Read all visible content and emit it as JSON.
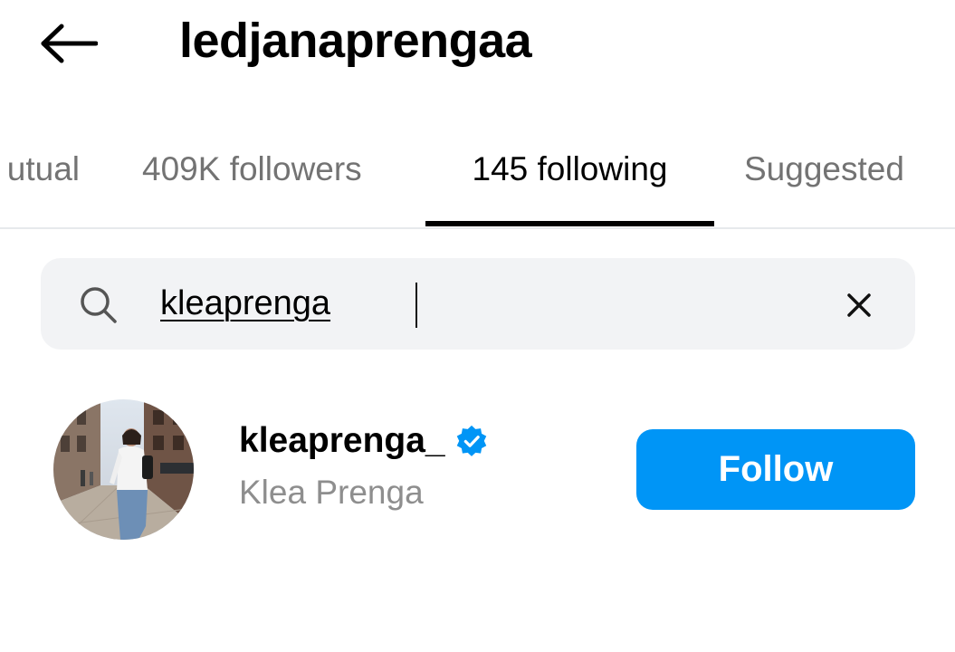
{
  "header": {
    "title": "ledjanaprengaa",
    "back_icon": "arrow-left-icon"
  },
  "tabs": [
    {
      "label": "utual",
      "active": false
    },
    {
      "label": "409K followers",
      "active": false
    },
    {
      "label": "145 following",
      "active": true
    },
    {
      "label": "Suggested",
      "active": false
    }
  ],
  "search": {
    "value": "kleaprenga",
    "icon": "search-icon",
    "clear_icon": "close-icon"
  },
  "results": [
    {
      "username": "kleaprenga_",
      "verified": true,
      "full_name": "Klea Prenga",
      "button_label": "Follow"
    }
  ],
  "colors": {
    "accent": "#0095f6",
    "verified": "#0095f6",
    "search_bg": "#f2f3f5",
    "muted_text": "#737373"
  }
}
